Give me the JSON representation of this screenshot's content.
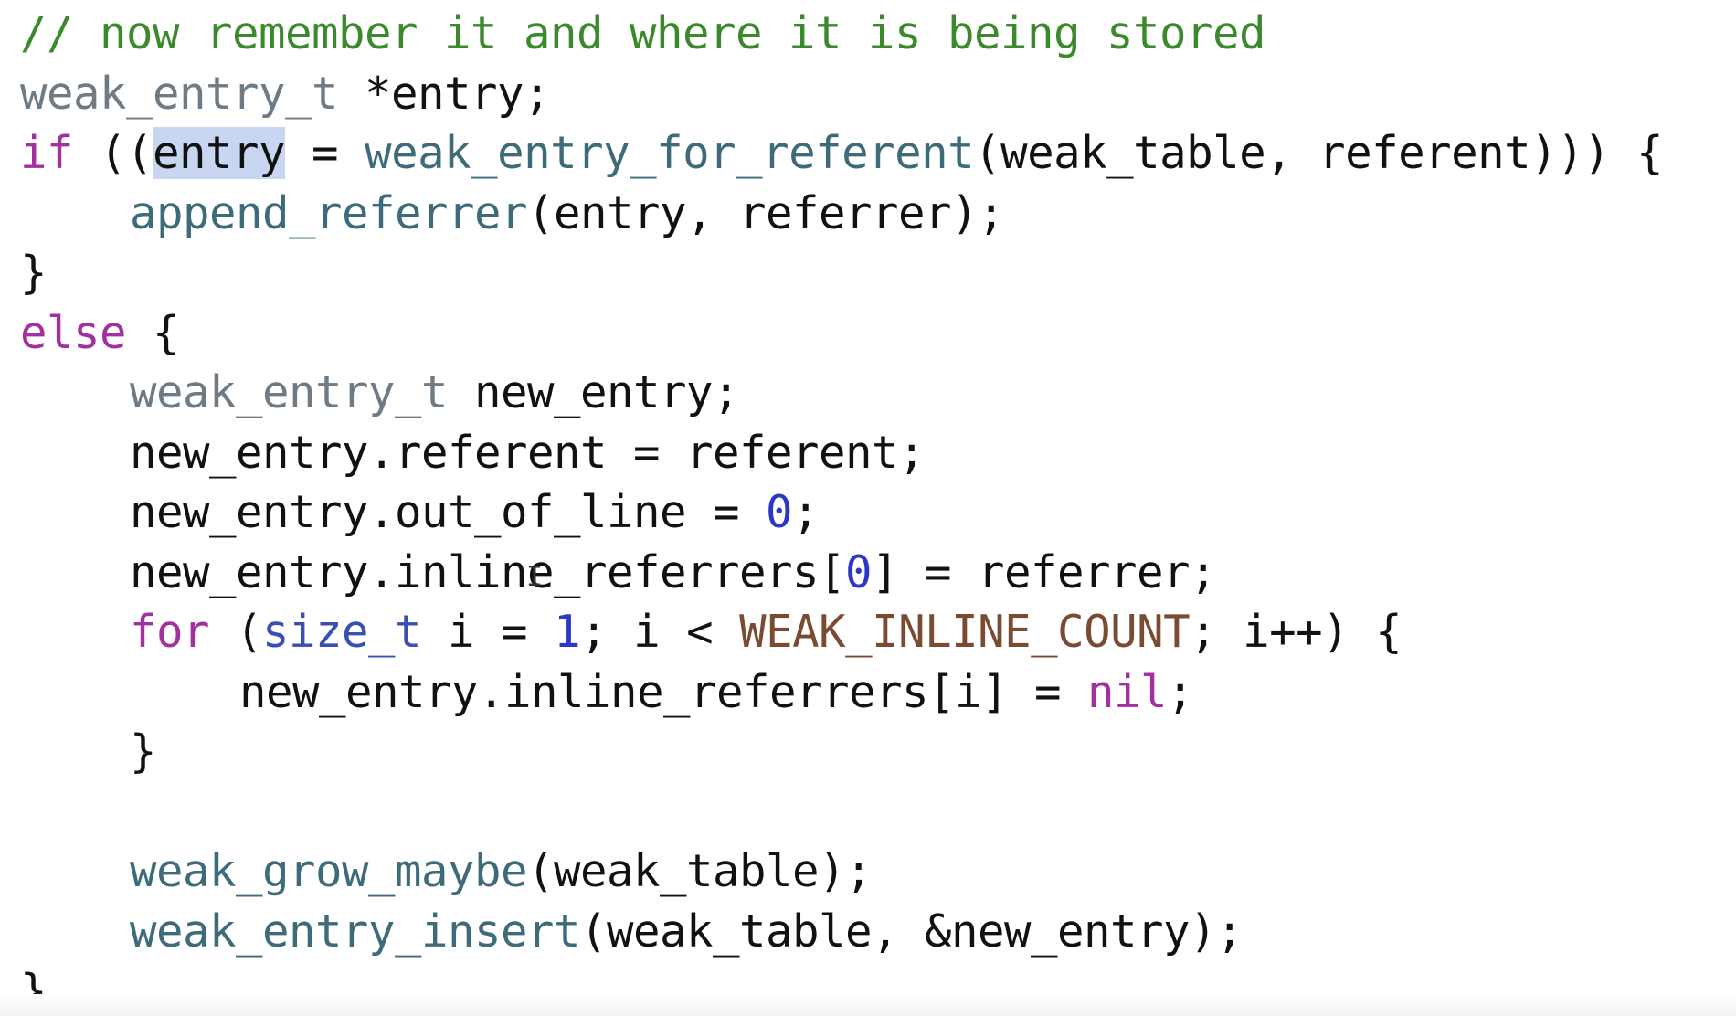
{
  "code": {
    "l1": {
      "comment": "// now remember it and where it is being stored"
    },
    "l2": {
      "type": "weak_entry_t",
      "rest": " *entry;"
    },
    "l3": {
      "kw": "if",
      "a": " ((",
      "hl": "entry",
      "b": " = ",
      "fn": "weak_entry_for_referent",
      "c": "(weak_table, referent))) {"
    },
    "l4": {
      "fn": "append_referrer",
      "rest": "(entry, referrer);"
    },
    "l5": {
      "text": "}"
    },
    "l6": {
      "kw": "else",
      "rest": " {"
    },
    "l7": {
      "type": "weak_entry_t",
      "rest": " new_entry;"
    },
    "l8": {
      "text": "new_entry.referent = referent;"
    },
    "l9": {
      "a": "new_entry.out_of_line = ",
      "num": "0",
      "b": ";"
    },
    "l10": {
      "a": "new_entry.inline_referrers[",
      "num": "0",
      "b": "] = referrer;"
    },
    "l11": {
      "kw": "for",
      "a": " (",
      "type": "size_t",
      "b": " i = ",
      "num": "1",
      "c": "; i < ",
      "macro": "WEAK_INLINE_COUNT",
      "d": "; i++) {"
    },
    "l12": {
      "a": "new_entry.inline_referrers[i] = ",
      "kw": "nil",
      "b": ";"
    },
    "l13": {
      "text": "}"
    },
    "l14": {
      "text": ""
    },
    "l15": {
      "fn": "weak_grow_maybe",
      "rest": "(weak_table);"
    },
    "l16": {
      "fn": "weak_entry_insert",
      "rest": "(weak_table, &new_entry);"
    },
    "l17": {
      "text": "}"
    }
  },
  "cursor_glyph": "I",
  "colors": {
    "comment": "#3a8a2c",
    "type": "#6e7b85",
    "keyword": "#a2309e",
    "function": "#3e6b7a",
    "number": "#2a37c9",
    "macro": "#7a4a32",
    "selection": "#c9d6f1"
  }
}
